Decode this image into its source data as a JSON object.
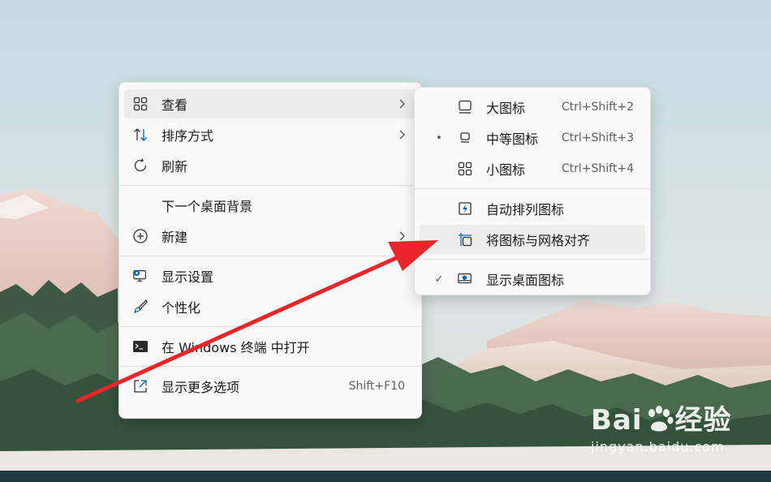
{
  "main_menu": {
    "items": [
      {
        "label": "查看",
        "icon": "view-grid-icon",
        "submenu": true
      },
      {
        "label": "排序方式",
        "icon": "sort-icon",
        "submenu": true
      },
      {
        "label": "刷新",
        "icon": "refresh-icon"
      },
      {
        "label": "下一个桌面背景"
      },
      {
        "label": "新建",
        "icon": "new-plus-icon",
        "submenu": true
      },
      {
        "label": "显示设置",
        "icon": "display-settings-icon"
      },
      {
        "label": "个性化",
        "icon": "brush-icon"
      },
      {
        "label": "在 Windows 终端 中打开",
        "icon": "terminal-icon"
      },
      {
        "label": "显示更多选项",
        "icon": "more-options-icon",
        "shortcut": "Shift+F10"
      }
    ]
  },
  "view_submenu": {
    "items": [
      {
        "label": "大图标",
        "icon": "large-icons-icon",
        "shortcut": "Ctrl+Shift+2"
      },
      {
        "label": "中等图标",
        "icon": "medium-icons-icon",
        "shortcut": "Ctrl+Shift+3",
        "mark": "•"
      },
      {
        "label": "小图标",
        "icon": "small-icons-icon",
        "shortcut": "Ctrl+Shift+4"
      },
      {
        "label": "自动排列图标",
        "icon": "auto-arrange-icon"
      },
      {
        "label": "将图标与网格对齐",
        "icon": "align-grid-icon"
      },
      {
        "label": "显示桌面图标",
        "icon": "show-desktop-icons-icon",
        "mark": "✓"
      }
    ]
  },
  "watermark": {
    "brand": "Bai",
    "brand2": "经验",
    "url": "jingyan.baidu.com"
  },
  "colors": {
    "accent": "#0067c0",
    "arrow": "#e8262a"
  }
}
